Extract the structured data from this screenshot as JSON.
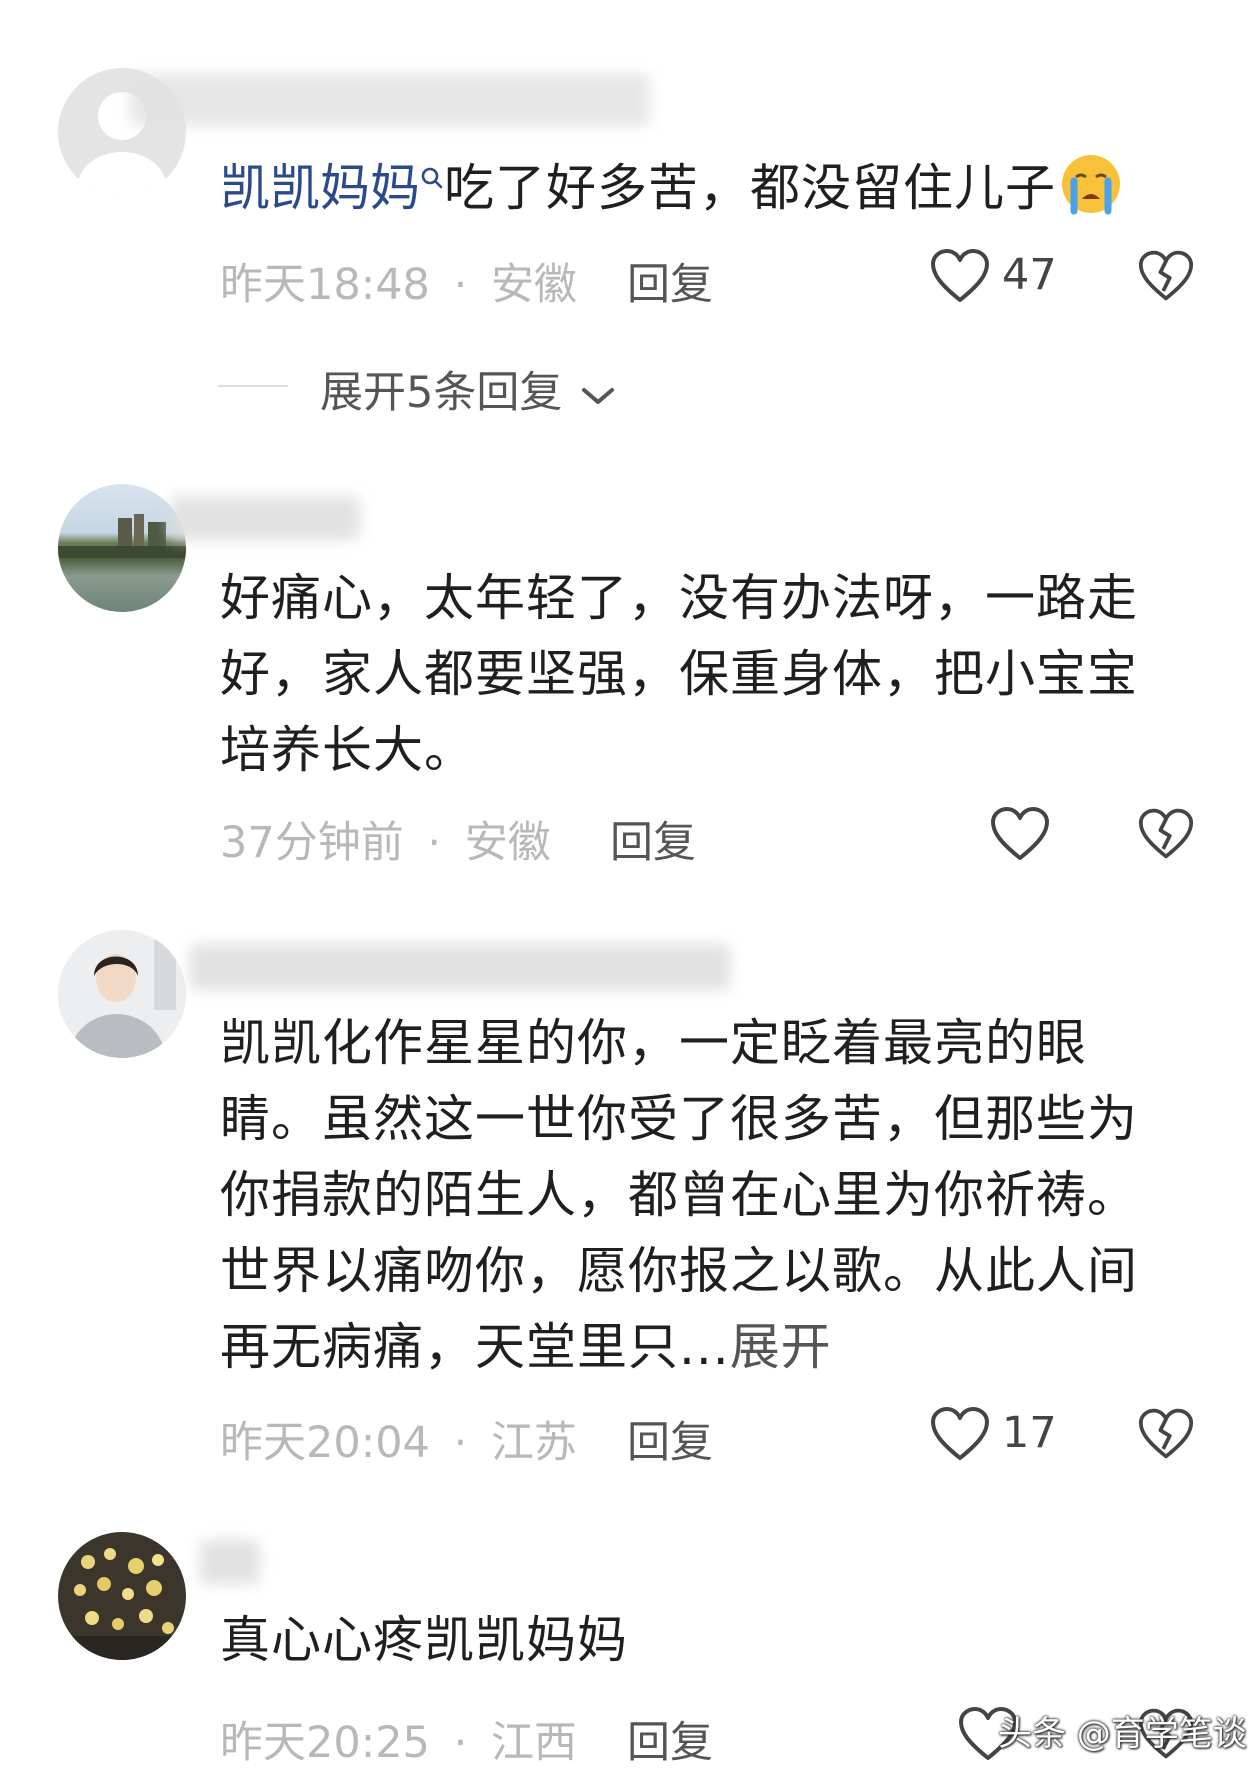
{
  "comments": [
    {
      "author": "凯凯妈妈",
      "text": "吃了好多苦，都没留住儿子",
      "time": "昨天18:48",
      "location": "安徽",
      "reply_label": "回复",
      "likes": "47",
      "expand_replies": "展开5条回复",
      "emoji": "crying-face"
    },
    {
      "text": "好痛心，太年轻了，没有办法呀，一路走好，家人都要坚强，保重身体，把小宝宝培养长大。",
      "time": "37分钟前",
      "location": "安徽",
      "reply_label": "回复"
    },
    {
      "text": "凯凯化作星星的你，一定眨着最亮的眼睛。虽然这一世你受了很多苦，但那些为你捐款的陌生人，都曾在心里为你祈祷。世界以痛吻你，愿你报之以歌。从此人间再无病痛，天堂里只...",
      "expand_label": "展开",
      "time": "昨天20:04",
      "location": "江苏",
      "reply_label": "回复",
      "likes": "17"
    },
    {
      "text": "真心心疼凯凯妈妈",
      "time": "昨天20:25",
      "location": "江西",
      "reply_label": "回复"
    }
  ],
  "separator": "·",
  "watermark": "头条 @育学笔谈",
  "colors": {
    "author": "#2b4a8c",
    "meta": "#b8b8b8",
    "text": "#1f1f1f"
  }
}
